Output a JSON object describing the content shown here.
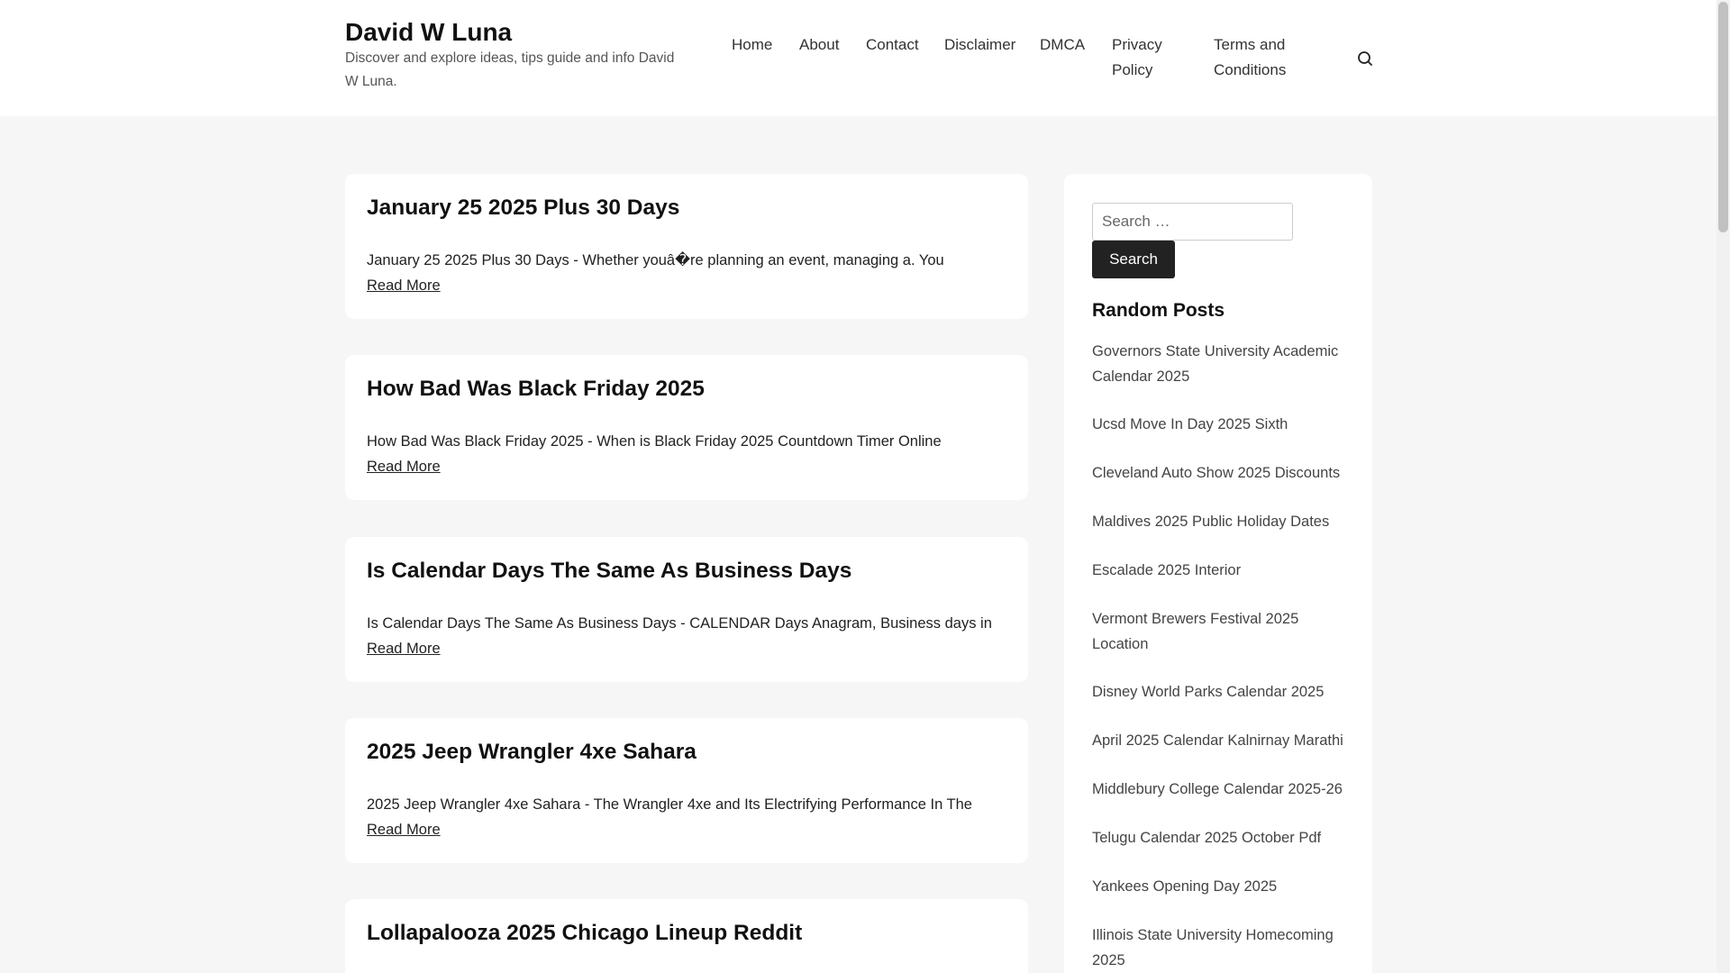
{
  "site": {
    "title": "David W Luna",
    "description": "Discover and explore ideas, tips guide and info David W Luna."
  },
  "nav": {
    "items": [
      {
        "label": "Home"
      },
      {
        "label": "About"
      },
      {
        "label": "Contact"
      },
      {
        "label": "Disclaimer"
      },
      {
        "label": "DMCA"
      },
      {
        "label": "Privacy Policy"
      },
      {
        "label": "Terms and Conditions"
      }
    ],
    "search_icon": "search-icon"
  },
  "articles": [
    {
      "title": "January 25 2025 Plus 30 Days",
      "excerpt": "January 25 2025 Plus 30 Days - Whether youâ�re planning an event, managing a. You",
      "read_more": "Read More"
    },
    {
      "title": "How Bad Was Black Friday 2025",
      "excerpt": "How Bad Was Black Friday 2025 - When is Black Friday 2025 Countdown Timer Online",
      "read_more": "Read More"
    },
    {
      "title": "Is Calendar Days The Same As Business Days",
      "excerpt": "Is Calendar Days The Same As Business Days - CALENDAR Days Anagram, Business days in",
      "read_more": "Read More"
    },
    {
      "title": "2025 Jeep Wrangler 4xe Sahara",
      "excerpt": "2025 Jeep Wrangler 4xe Sahara - The Wrangler 4xe and Its Electrifying Performance In The",
      "read_more": "Read More"
    },
    {
      "title": "Lollapalooza 2025 Chicago Lineup Reddit"
    }
  ],
  "sidebar": {
    "search": {
      "placeholder": "Search …",
      "value": "",
      "button_label": "Search"
    },
    "random_posts": {
      "title": "Random Posts",
      "items": [
        {
          "label": "Governors State University Academic Calendar 2025"
        },
        {
          "label": "Ucsd Move In Day 2025 Sixth"
        },
        {
          "label": "Cleveland Auto Show 2025 Discounts"
        },
        {
          "label": "Maldives 2025 Public Holiday Dates"
        },
        {
          "label": "Escalade 2025 Interior"
        },
        {
          "label": "Vermont Brewers Festival 2025 Location"
        },
        {
          "label": "Disney World Parks Calendar 2025"
        },
        {
          "label": "April 2025 Calendar Kalnirnay Marathi"
        },
        {
          "label": "Middlebury College Calendar 2025-26"
        },
        {
          "label": "Telugu Calendar 2025 October Pdf"
        },
        {
          "label": "Yankees Opening Day 2025"
        },
        {
          "label": "Illinois State University Homecoming 2025"
        }
      ]
    }
  },
  "colors": {
    "background": "#f6f6f6",
    "card": "#ffffff",
    "button": "#222222"
  }
}
